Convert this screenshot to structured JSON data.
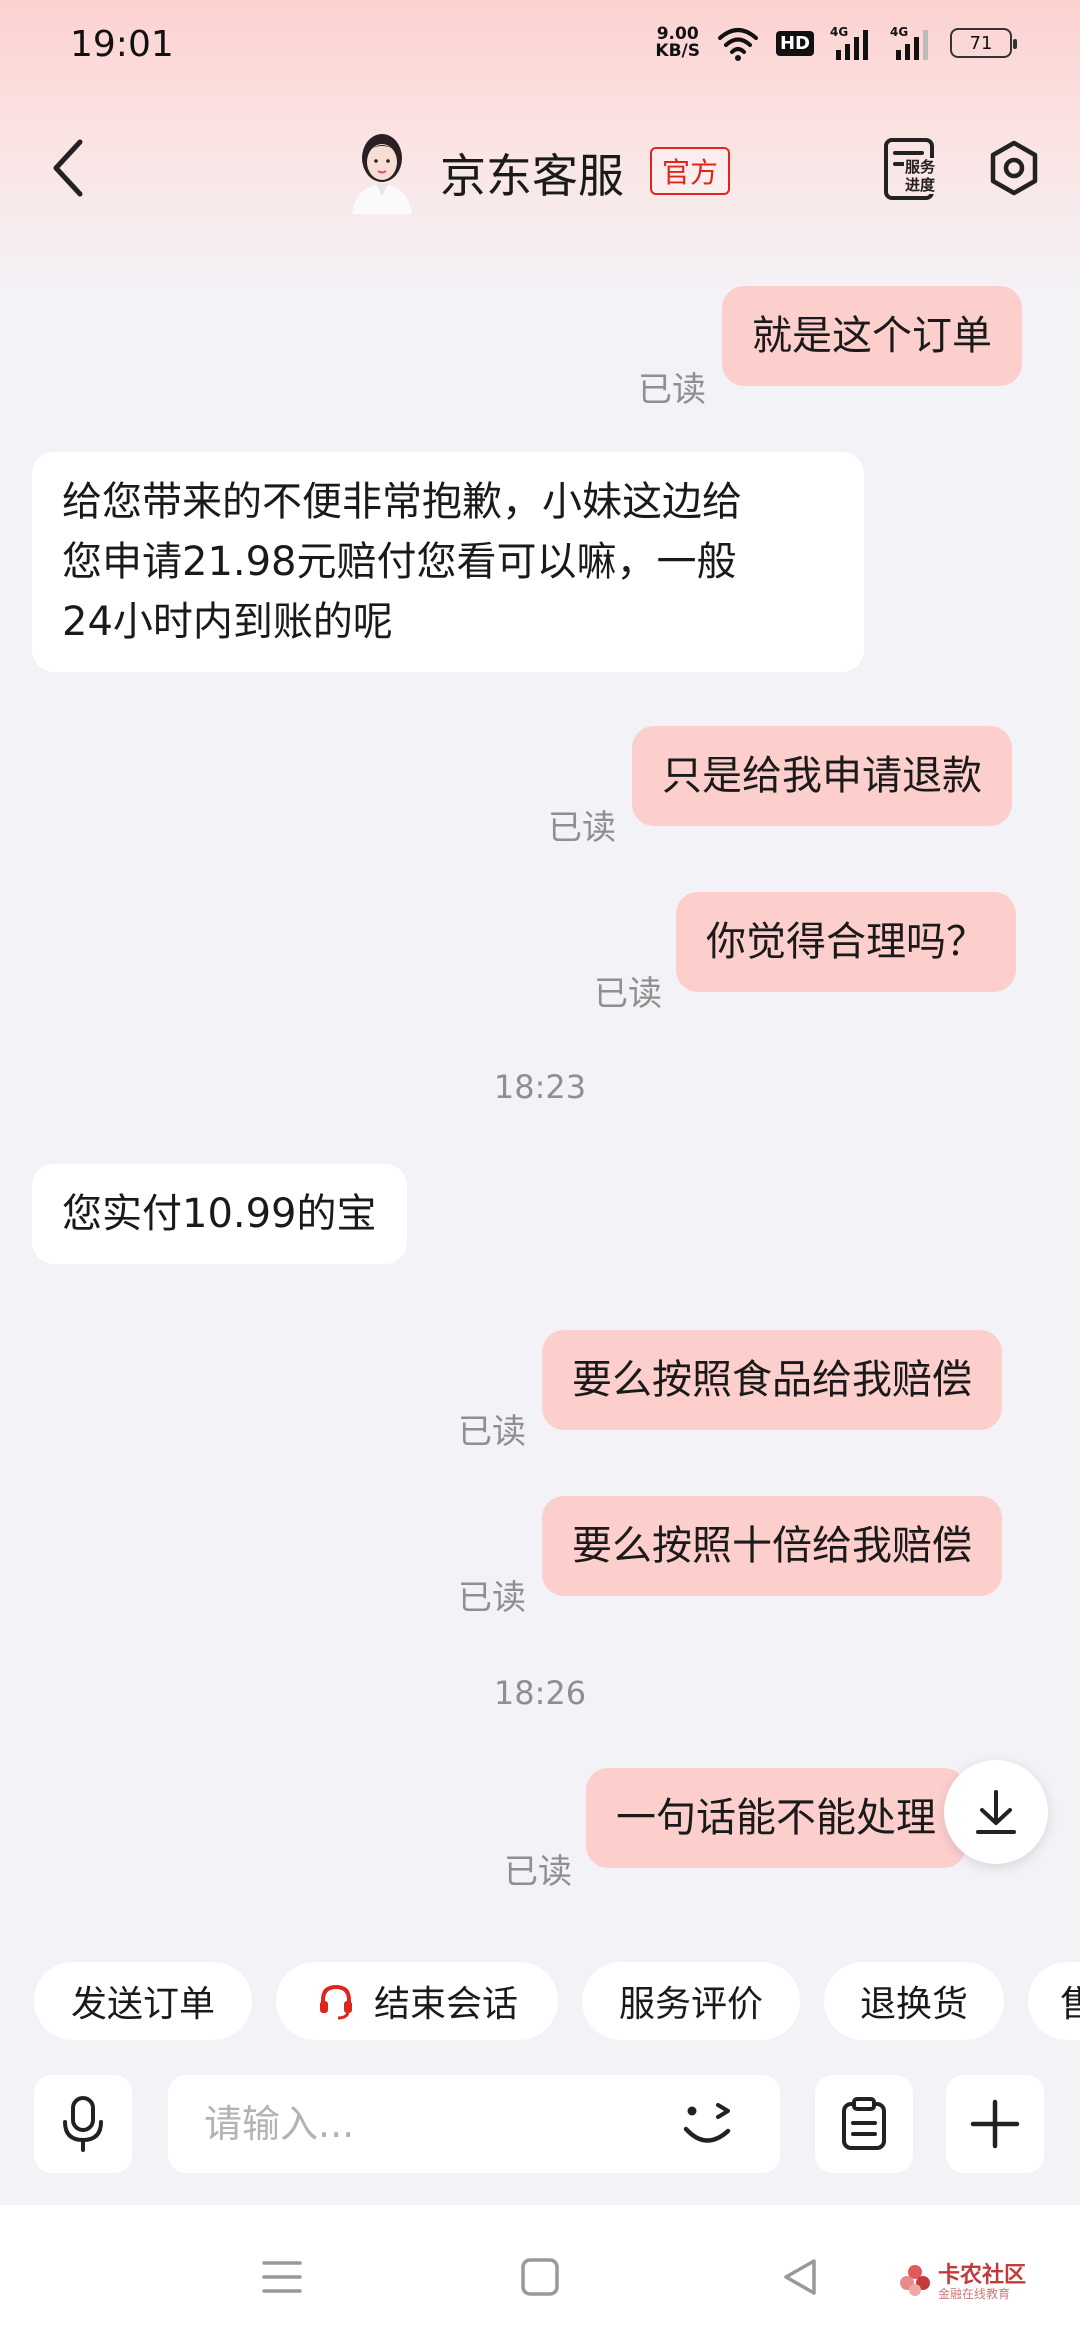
{
  "status_bar": {
    "time": "19:01",
    "net_speed_value": "9.00",
    "net_speed_unit": "KB/S",
    "hd_label": "HD",
    "signal1_label": "4G",
    "signal2_label": "4G",
    "battery": "71"
  },
  "header": {
    "title": "京东客服",
    "badge": "官方",
    "progress_label_line1": "服务",
    "progress_label_line2": "进度"
  },
  "messages": [
    {
      "direction": "out",
      "text": "就是这个订单",
      "status": "已读"
    },
    {
      "direction": "in",
      "lines": [
        "给您带来的不便非常抱歉，小妹这边给",
        "您申请21.98元赔付您看可以嘛，一般",
        "24小时内到账的呢"
      ]
    },
    {
      "direction": "out",
      "text": "只是给我申请退款",
      "status": "已读"
    },
    {
      "direction": "out",
      "text": "你觉得合理吗？",
      "status": "已读"
    },
    {
      "type": "time",
      "text": "18:23"
    },
    {
      "direction": "in",
      "text": "您实付10.99的宝"
    },
    {
      "direction": "out",
      "text": "要么按照食品给我赔偿",
      "status": "已读"
    },
    {
      "direction": "out",
      "text": "要么按照十倍给我赔偿",
      "status": "已读"
    },
    {
      "type": "time",
      "text": "18:26"
    },
    {
      "direction": "out",
      "text": "一句话能不能处理",
      "status": "已读"
    }
  ],
  "quick_actions": [
    "发送订单",
    "结束会话",
    "服务评价",
    "退换货",
    "售"
  ],
  "input": {
    "placeholder": "请输入..."
  },
  "watermark": {
    "title": "卡农社区",
    "subtitle": "金融在线教育"
  }
}
